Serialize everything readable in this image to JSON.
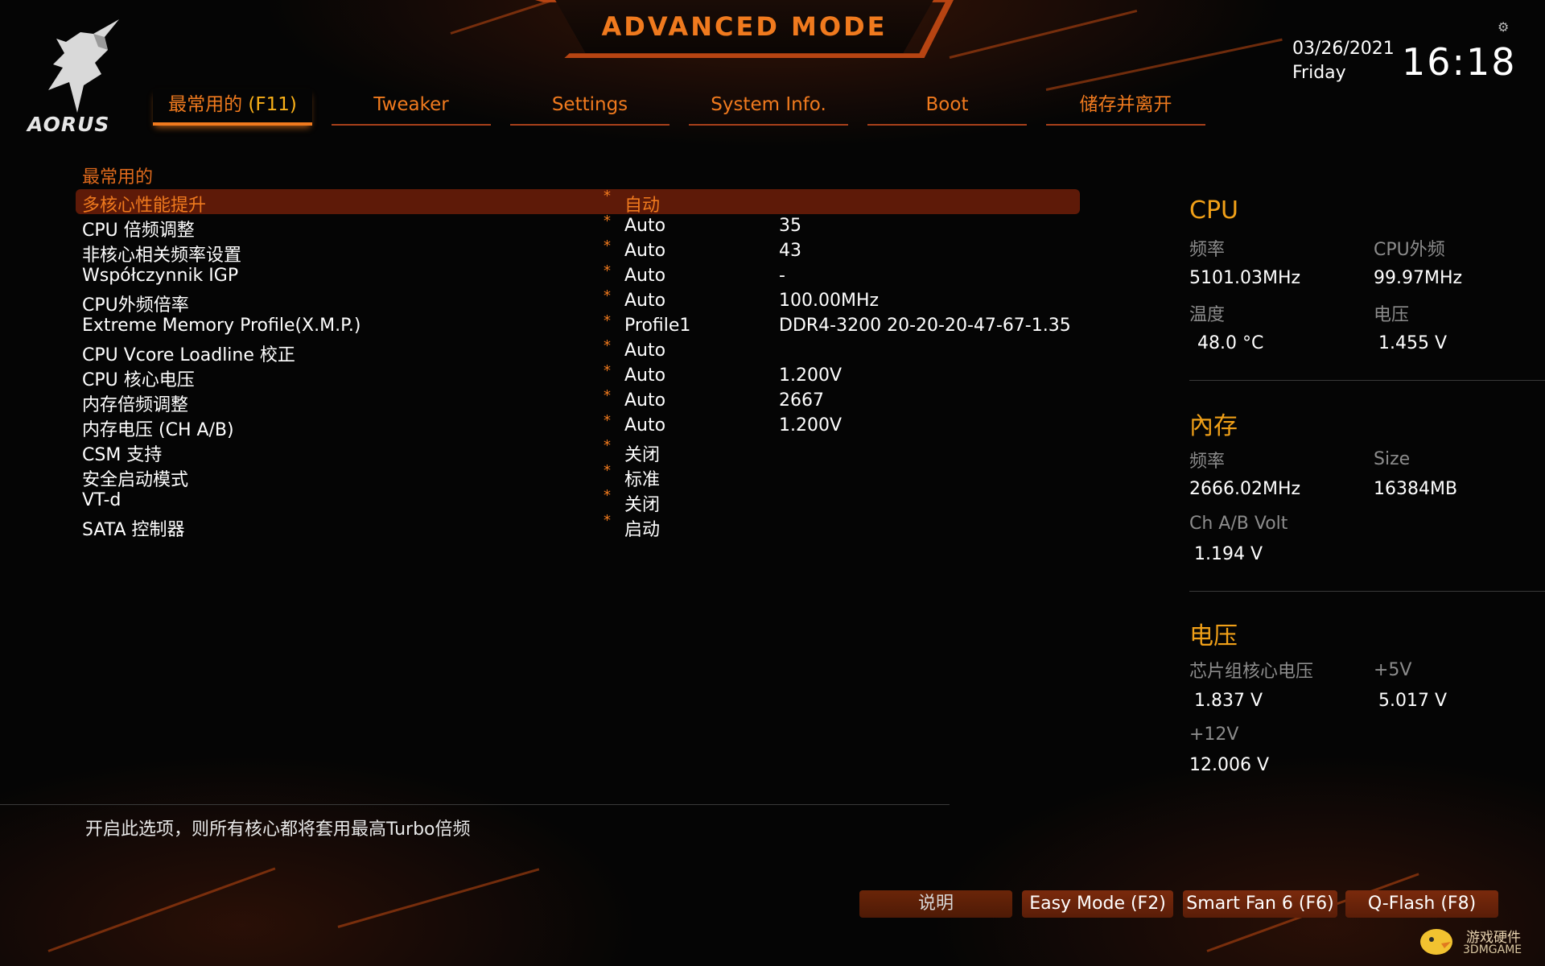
{
  "header": {
    "mode_title": "ADVANCED MODE",
    "brand": "AORUS",
    "date": "03/26/2021",
    "day": "Friday",
    "time": "16:18"
  },
  "tabs": [
    {
      "label": "最常用的",
      "key": "(F11)",
      "active": true
    },
    {
      "label": "Tweaker"
    },
    {
      "label": "Settings"
    },
    {
      "label": "System Info."
    },
    {
      "label": "Boot"
    },
    {
      "label": "储存并离开"
    }
  ],
  "section_title": "最常用的",
  "settings": [
    {
      "label": "多核心性能提升",
      "value": "自动",
      "current": "",
      "selected": true
    },
    {
      "label": "CPU 倍频调整",
      "value": "Auto",
      "current": "35"
    },
    {
      "label": "非核心相关频率设置",
      "value": "Auto",
      "current": "43"
    },
    {
      "label": "Współczynnik IGP",
      "value": "Auto",
      "current": "-"
    },
    {
      "label": "CPU外频倍率",
      "value": "Auto",
      "current": "100.00MHz"
    },
    {
      "label": "Extreme Memory Profile(X.M.P.)",
      "value": "Profile1",
      "current": "DDR4-3200 20-20-20-47-67-1.35"
    },
    {
      "label": "CPU Vcore Loadline 校正",
      "value": "Auto",
      "current": ""
    },
    {
      "label": "CPU 核心电压",
      "value": "Auto",
      "current": "1.200V"
    },
    {
      "label": "内存倍频调整",
      "value": "Auto",
      "current": "2667"
    },
    {
      "label": "内存电压 (CH A/B)",
      "value": "Auto",
      "current": "1.200V"
    },
    {
      "label": "CSM 支持",
      "value": "关闭",
      "current": ""
    },
    {
      "label": "安全启动模式",
      "value": "标准",
      "current": ""
    },
    {
      "label": "VT-d",
      "value": "关闭",
      "current": ""
    },
    {
      "label": "SATA 控制器",
      "value": "启动",
      "current": ""
    }
  ],
  "star_glyph": "*",
  "help_text": "开启此选项，则所有核心都将套用最高Turbo倍频",
  "monitor": {
    "cpu": {
      "title": "CPU",
      "freq_label": "频率",
      "freq": "5101.03MHz",
      "bclk_label": "CPU外频",
      "bclk": "99.97MHz",
      "temp_label": "温度",
      "temp": "48.0 °C",
      "volt_label": "电压",
      "volt": "1.455 V"
    },
    "memory": {
      "title": "內存",
      "freq_label": "频率",
      "freq": "2666.02MHz",
      "size_label": "Size",
      "size": "16384MB",
      "volt_label": "Ch A/B Volt",
      "volt": "1.194 V"
    },
    "voltage": {
      "title": "电压",
      "chipset_label": "芯片组核心电压",
      "chipset": "1.837 V",
      "p5v_label": "+5V",
      "p5v": "5.017 V",
      "p12v_label": "+12V",
      "p12v": "12.006 V"
    }
  },
  "footer": {
    "help_btn": "说明",
    "easy_mode": "Easy Mode (F2)",
    "smart_fan": "Smart Fan 6 (F6)",
    "qflash": "Q-Flash (F8)"
  },
  "watermark": {
    "line1": "游戏硬件",
    "line2": "3DMGAME"
  },
  "colors": {
    "accent": "#f07a1e",
    "title_gold": "#f0a018",
    "selected_row": "#5e1a08"
  }
}
